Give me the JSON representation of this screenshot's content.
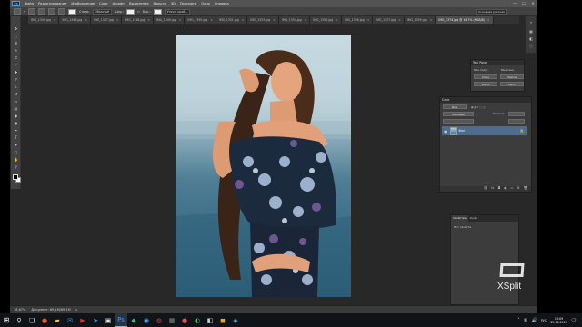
{
  "menu": [
    "Файл",
    "Редактирование",
    "Изображение",
    "Слои",
    "Шрифт",
    "Выделение",
    "Фильтр",
    "3D",
    "Просмотр",
    "Окно",
    "Справка"
  ],
  "window_controls": [
    "—",
    "☐",
    "✕"
  ],
  "options": {
    "size_value": "",
    "style_label": "Стиль:",
    "style_value": "Обычный",
    "width_label": "Шир.:",
    "height_label": "Выс.:",
    "refine_label": "Уточн. край...",
    "workspace_label": "Основная рабочая среда"
  },
  "tabs": [
    {
      "label": "IMG_1345.jpg",
      "active": false
    },
    {
      "label": "IMG_1346.jpg",
      "active": false
    },
    {
      "label": "IMG_1347.jpg",
      "active": false
    },
    {
      "label": "IMG_1348.jpg",
      "active": false
    },
    {
      "label": "IMG_1349.jpg",
      "active": false
    },
    {
      "label": "IMG_1350.jpg",
      "active": false
    },
    {
      "label": "IMG_1351.jpg",
      "active": false
    },
    {
      "label": "IMG_1353.jpg",
      "active": false
    },
    {
      "label": "IMG_1354.jpg",
      "active": false
    },
    {
      "label": "IMG_1355.jpg",
      "active": false
    },
    {
      "label": "IMG_1356.jpg",
      "active": false
    },
    {
      "label": "IMG_1357.jpg",
      "active": false
    },
    {
      "label": "IMG_1359.jpg",
      "active": false
    },
    {
      "label": "IMG_1374.jpg @ 16,7% (RGB/8)",
      "active": true
    }
  ],
  "status": {
    "zoom": "16,67%",
    "doc": "Документ: 69,1M/69,1M"
  },
  "tool_panel": {
    "title": "Tool Panel",
    "btn1": "Clone",
    "btn2": "Healing",
    "btn3": "Stamp",
    "btn4": "Patch",
    "label1": "Мин.полут.",
    "label2": "Мин.тени"
  },
  "layers": {
    "title": "Слои",
    "filter_label": "Вид",
    "blend_mode": "Обычные",
    "opacity_label": "Непрозр.:",
    "layer_name": "Фон"
  },
  "properties": {
    "tab1": "Свойства",
    "tab2": "Инфо",
    "content": "Нет свойств"
  },
  "watermark": "XSplit",
  "taskbar": {
    "lang": "РУС",
    "time": "18:09",
    "date": "25.06.2017"
  }
}
